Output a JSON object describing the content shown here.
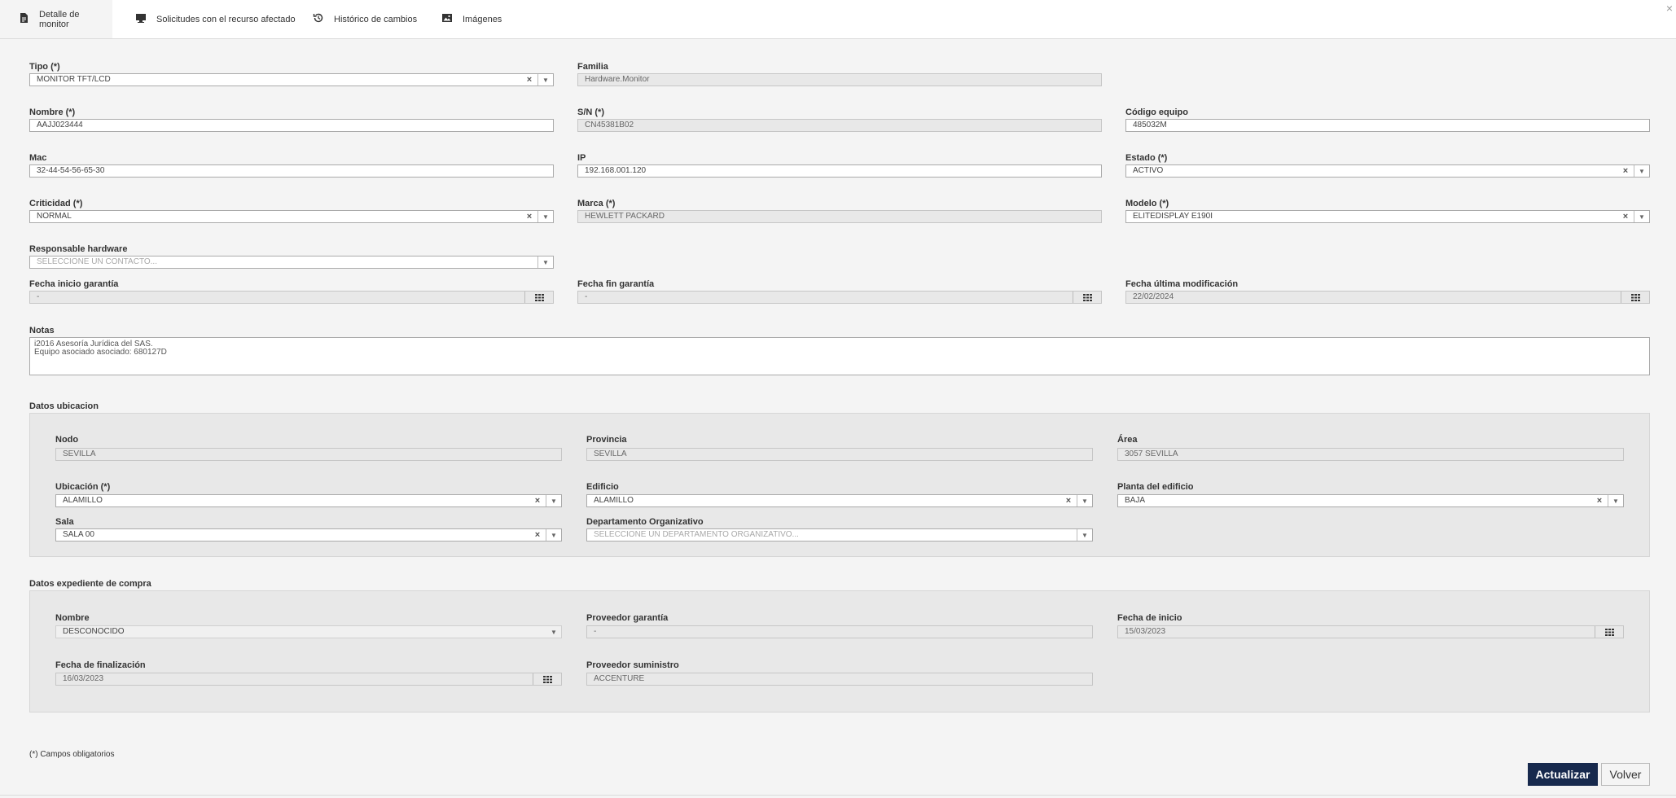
{
  "tabs": [
    {
      "label": "Detalle de monitor",
      "icon": "document-icon"
    },
    {
      "label": "Solicitudes con el recurso afectado",
      "icon": "monitor-icon"
    },
    {
      "label": "Histórico de cambios",
      "icon": "history-icon"
    },
    {
      "label": "Imágenes",
      "icon": "image-icon"
    }
  ],
  "close_label": "×",
  "form": {
    "tipo": {
      "label": "Tipo (*)",
      "value": "MONITOR TFT/LCD"
    },
    "familia": {
      "label": "Familia",
      "value": "Hardware.Monitor"
    },
    "nombre": {
      "label": "Nombre (*)",
      "value": "AAJJ023444"
    },
    "sn": {
      "label": "S/N (*)",
      "value": "CN45381B02"
    },
    "codigo": {
      "label": "Código equipo",
      "value": "485032M"
    },
    "mac": {
      "label": "Mac",
      "value": "32-44-54-56-65-30"
    },
    "ip": {
      "label": "IP",
      "value": "192.168.001.120"
    },
    "estado": {
      "label": "Estado (*)",
      "value": "ACTIVO"
    },
    "criticidad": {
      "label": "Criticidad (*)",
      "value": "NORMAL"
    },
    "marca": {
      "label": "Marca (*)",
      "value": "HEWLETT PACKARD"
    },
    "modelo": {
      "label": "Modelo (*)",
      "value": "ELITEDISPLAY E190I"
    },
    "responsable": {
      "label": "Responsable hardware",
      "placeholder": "SELECCIONE UN CONTACTO..."
    },
    "fecha_inicio_garantia": {
      "label": "Fecha inicio garantía",
      "value": "-"
    },
    "fecha_fin_garantia": {
      "label": "Fecha fin garantía",
      "value": "-"
    },
    "fecha_ultima_mod": {
      "label": "Fecha última modificación",
      "value": "22/02/2024"
    },
    "notas": {
      "label": "Notas",
      "value": "i2016 Asesoría Jurídica del SAS.\nEquipo asociado asociado: 680127D"
    }
  },
  "ubicacion": {
    "title": "Datos ubicacion",
    "nodo": {
      "label": "Nodo",
      "value": "SEVILLA"
    },
    "provincia": {
      "label": "Provincia",
      "value": "SEVILLA"
    },
    "area": {
      "label": "Área",
      "value": "3057 SEVILLA"
    },
    "ubicacion": {
      "label": "Ubicación (*)",
      "value": "ALAMILLO"
    },
    "edificio": {
      "label": "Edificio",
      "value": "ALAMILLO"
    },
    "planta": {
      "label": "Planta del edificio",
      "value": "BAJA"
    },
    "sala": {
      "label": "Sala",
      "value": "SALA 00"
    },
    "departamento": {
      "label": "Departamento Organizativo",
      "placeholder": "SELECCIONE UN DEPARTAMENTO ORGANIZATIVO..."
    }
  },
  "compra": {
    "title": "Datos expediente de compra",
    "nombre": {
      "label": "Nombre",
      "value": "DESCONOCIDO"
    },
    "proveedor_garantia": {
      "label": "Proveedor garantía",
      "value": "-"
    },
    "fecha_inicio": {
      "label": "Fecha de inicio",
      "value": "15/03/2023"
    },
    "fecha_finalizacion": {
      "label": "Fecha de finalización",
      "value": "16/03/2023"
    },
    "proveedor_suministro": {
      "label": "Proveedor suministro",
      "value": "ACCENTURE"
    }
  },
  "footer": {
    "required_note": "(*) Campos obligatorios",
    "update_label": "Actualizar",
    "back_label": "Volver"
  },
  "colors": {
    "primary_button": "#17294d",
    "page_bg": "#f4f4f4",
    "panel_bg": "#e8e8e8"
  }
}
